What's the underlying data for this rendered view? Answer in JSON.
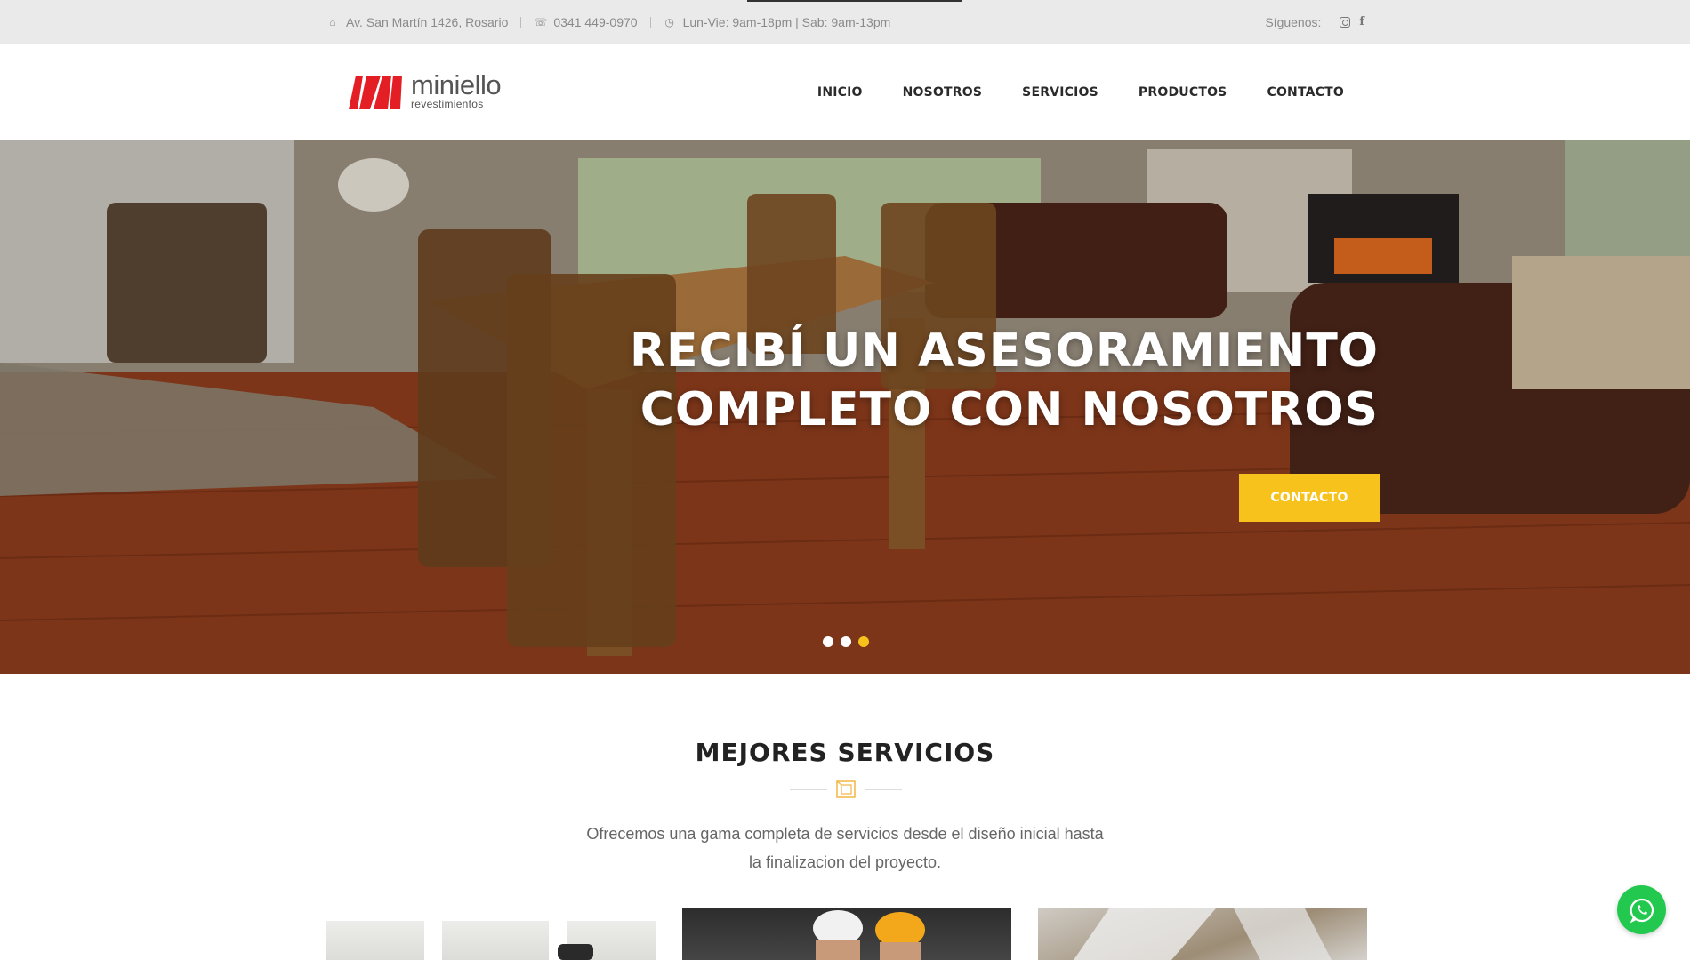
{
  "topbar": {
    "address": "Av. San Martín 1426, Rosario",
    "phone": "0341 449-0970",
    "hours": "Lun-Vie: 9am-18pm | Sab: 9am-13pm",
    "follow_label": "Síguenos:",
    "icons": [
      "map-marker-icon",
      "phone-icon",
      "clock-icon",
      "instagram-icon",
      "facebook-icon"
    ]
  },
  "brand": {
    "name": "miniello",
    "tagline": "revestimientos",
    "logo_color": "#e31e24"
  },
  "nav": {
    "items": [
      "INICIO",
      "NOSOTROS",
      "SERVICIOS",
      "PRODUCTOS",
      "CONTACTO"
    ]
  },
  "hero": {
    "title_line1": "RECIBÍ UN ASESORAMIENTO",
    "title_line2": "COMPLETO CON NOSOTROS",
    "button_label": "CONTACTO",
    "slides": 3,
    "active_slide": 3,
    "accent_color": "#f7c21b"
  },
  "services": {
    "title": "MEJORES SERVICIOS",
    "desc_line1": "Ofrecemos una gama completa de servicios desde el diseño inicial hasta",
    "desc_line2": "la finalizacion del proyecto.",
    "cards": 3
  },
  "whatsapp": {
    "icon": "whatsapp-icon",
    "color": "#23c84f"
  }
}
